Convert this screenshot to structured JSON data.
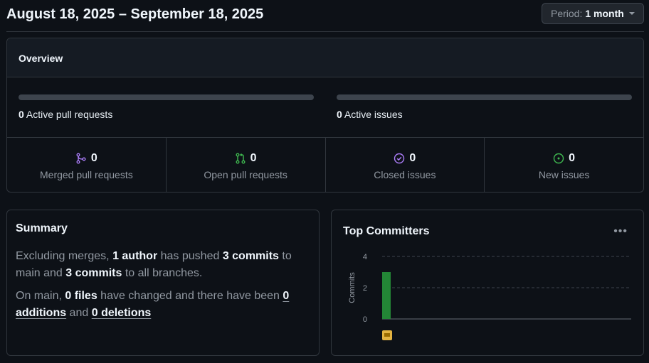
{
  "header": {
    "date_range": "August 18, 2025 – September 18, 2025",
    "period_prefix": "Period:",
    "period_value": "1 month"
  },
  "overview": {
    "title": "Overview",
    "active_prs": {
      "count": "0",
      "label": "Active pull requests"
    },
    "active_issues": {
      "count": "0",
      "label": "Active issues"
    },
    "stats": [
      {
        "count": "0",
        "label": "Merged pull requests",
        "icon": "git-merge-icon",
        "color": "#ab7df8"
      },
      {
        "count": "0",
        "label": "Open pull requests",
        "icon": "git-pull-request-icon",
        "color": "#3fb950"
      },
      {
        "count": "0",
        "label": "Closed issues",
        "icon": "issue-closed-icon",
        "color": "#ab7df8"
      },
      {
        "count": "0",
        "label": "New issues",
        "icon": "issue-opened-icon",
        "color": "#3fb950"
      }
    ]
  },
  "summary": {
    "title": "Summary",
    "p1": {
      "t1": "Excluding merges, ",
      "authors": "1 author",
      "t2": " has pushed ",
      "commits_main": "3 commits",
      "t3": " to main and ",
      "commits_all": "3 commits",
      "t4": " to all branches."
    },
    "p2": {
      "t1": "On main, ",
      "files": "0 files",
      "t2": " have changed and there have been ",
      "additions_num": "0",
      "additions_word": "additions",
      "t3": " and ",
      "deletions_num": "0",
      "deletions_word": "deletions"
    }
  },
  "committers": {
    "title": "Top Committers",
    "menu_icon": "kebab-horizontal-icon"
  },
  "chart_data": {
    "type": "bar",
    "ylabel": "Commits",
    "ylim": [
      0,
      4
    ],
    "yticks": [
      "0",
      "2",
      "4"
    ],
    "categories": [
      "avatar"
    ],
    "values": [
      3
    ],
    "bar_color": "#238636",
    "grid": true
  }
}
